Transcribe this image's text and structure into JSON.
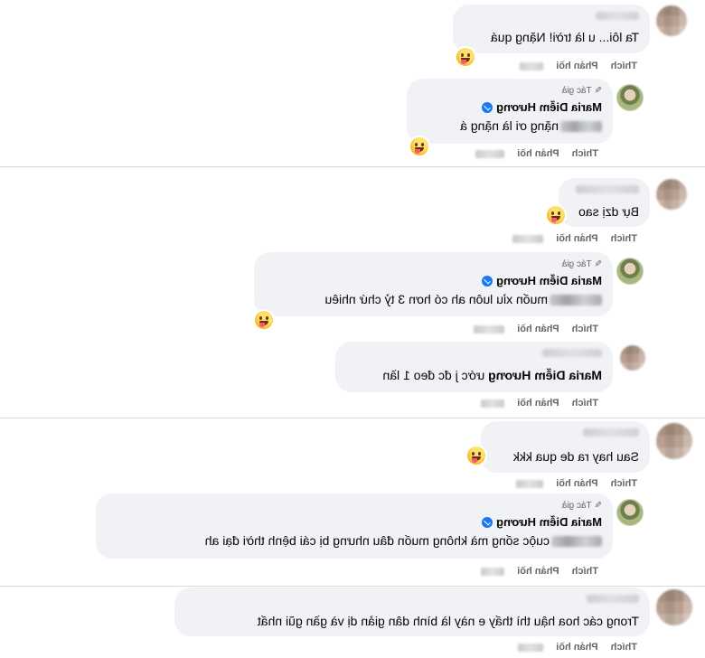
{
  "actions": {
    "like": "Thích",
    "reply": "Phản hồi"
  },
  "author_tag": "Tác giả",
  "author_name": "Maria Diễm Hương",
  "comments": [
    {
      "text": "Ta lôi... u là trời! Nặng quá"
    },
    {
      "text_after_blur": "nặng ơi là nặng á"
    },
    {
      "text": "Bự dzị sao"
    },
    {
      "text_after_blur": "muốn xỉu luôn ah có hơn 3 tỷ chứ nhiêu"
    },
    {
      "mention": "Maria Diễm Hương",
      "text_after_mention": " ước j đc đeo 1 lần"
    },
    {
      "text": "Sau hay ra de qua kkk"
    },
    {
      "text_after_blur": "cuộc sống mà không muốn đâu nhưng bị cái bệnh thời đại ah"
    },
    {
      "text": "Trong các hoa hậu thì thấy e này là bình dân giản dị và gần gũi nhất"
    }
  ],
  "icons": {
    "pencil": "pencil-icon",
    "verified": "verified-badge-icon",
    "reaction": "haha-reaction-icon"
  },
  "colors": {
    "bubble": "#f0f2f5",
    "meta_text": "#65676b",
    "verified": "#1877f2",
    "reaction": "#f7b928"
  }
}
